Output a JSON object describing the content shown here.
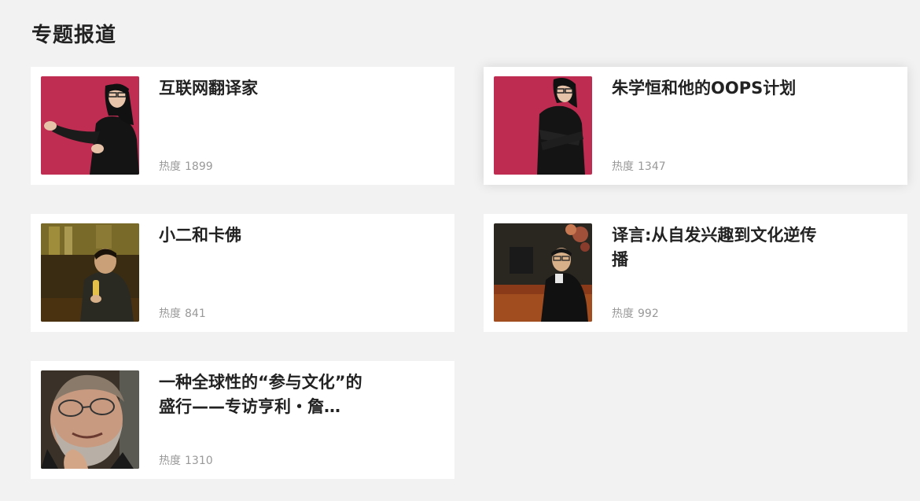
{
  "section": {
    "title": "专题报道",
    "heat_label": "热度"
  },
  "topics": [
    {
      "title": "互联网翻译家",
      "heat": "1899",
      "image": "portrait-man-long-hair-glasses-pink-backdrop-gesturing"
    },
    {
      "title": "朱学恒和他的OOPS计划",
      "heat": "1347",
      "image": "portrait-man-long-hair-glasses-pink-backdrop-arms-crossed"
    },
    {
      "title": "小二和卡佛",
      "heat": "841",
      "image": "photo-man-seated-in-bar-holding-bottle"
    },
    {
      "title": "译言:从自发兴趣到文化逆传播",
      "heat": "992",
      "image": "photo-man-glasses-sitting-on-floor-office"
    },
    {
      "title": "一种全球性的“参与文化”的盛行——专访亨利・詹…",
      "heat": "1310",
      "image": "portrait-bearded-man-glasses-closeup"
    }
  ],
  "colors": {
    "background": "#f2f2f2",
    "card": "#ffffff",
    "title_text": "#222222",
    "muted_text": "#999999",
    "pink_backdrop": "#c8325a"
  }
}
